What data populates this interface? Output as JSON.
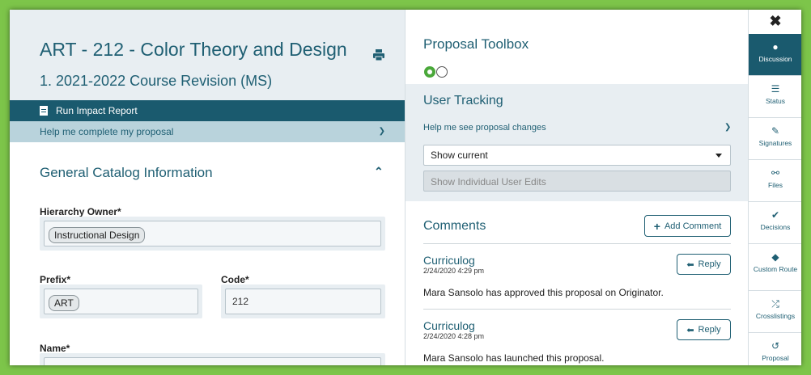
{
  "left": {
    "course_title": "ART - 212 - Color Theory and Design",
    "proposal_subtitle": "1. 2021-2022 Course Revision (MS)",
    "impact_report": "Run Impact Report",
    "help_complete": "Help me complete my proposal",
    "section_title": "General Catalog Information",
    "hierarchy_owner_label": "Hierarchy Owner*",
    "hierarchy_owner_value": "Instructional Design",
    "prefix_label": "Prefix*",
    "prefix_value": "ART",
    "code_label": "Code*",
    "code_value": "212",
    "name_label": "Name*"
  },
  "toolbox": {
    "title": "Proposal Toolbox",
    "user_tracking_title": "User Tracking",
    "help_changes": "Help me see proposal changes",
    "select_value": "Show current",
    "individual_edits": "Show Individual User Edits",
    "comments_title": "Comments",
    "add_comment": "Add Comment",
    "comments": [
      {
        "author": "Curriculog",
        "date": "2/24/2020 4:29 pm",
        "body": "Mara Sansolo has approved this proposal on Originator.",
        "reply": "Reply"
      },
      {
        "author": "Curriculog",
        "date": "2/24/2020 4:28 pm",
        "body": "Mara Sansolo has launched this proposal.",
        "reply": "Reply"
      }
    ]
  },
  "rail": {
    "items": [
      {
        "label": "Discussion",
        "icon": "speech-bubble-icon"
      },
      {
        "label": "Status",
        "icon": "list-icon"
      },
      {
        "label": "Signatures",
        "icon": "pen-icon"
      },
      {
        "label": "Files",
        "icon": "paperclip-icon"
      },
      {
        "label": "Decisions",
        "icon": "check-icon"
      },
      {
        "label": "Custom Route",
        "icon": "route-icon"
      },
      {
        "label": "Crosslistings",
        "icon": "shuffle-icon"
      },
      {
        "label": "Proposal",
        "icon": "history-icon"
      }
    ]
  },
  "colors": {
    "frame": "#7dc54a",
    "primary": "#1a5a6e",
    "text_accent": "#1f5f73",
    "panel": "#e8eef2"
  }
}
